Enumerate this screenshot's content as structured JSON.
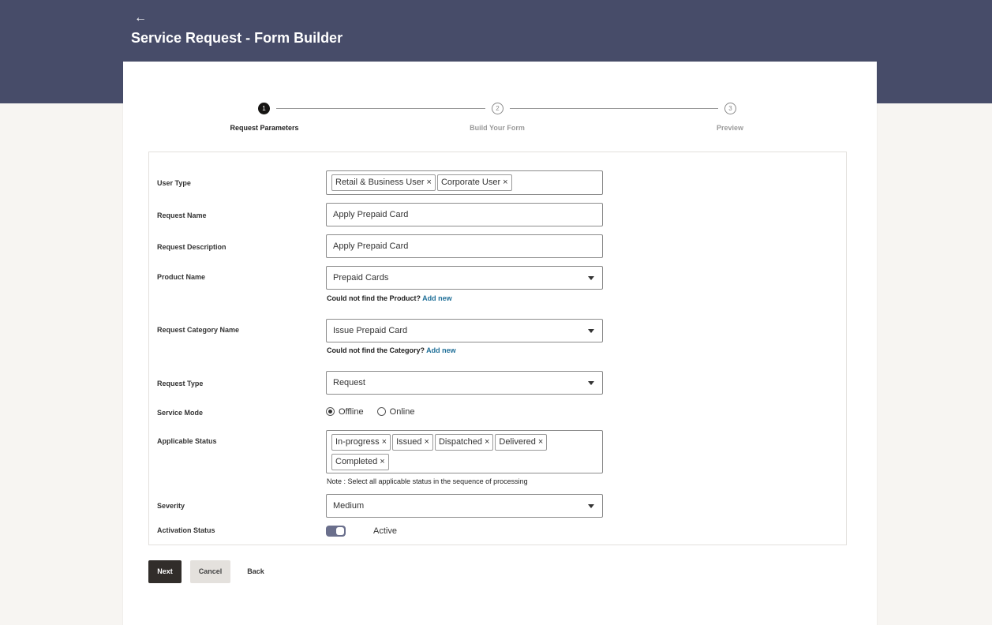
{
  "header": {
    "back_icon": "arrow-left-icon",
    "title": "Service Request - Form Builder"
  },
  "stepper": {
    "steps": [
      {
        "number": "1",
        "label": "Request Parameters",
        "state": "active"
      },
      {
        "number": "2",
        "label": "Build Your Form",
        "state": "pending"
      },
      {
        "number": "3",
        "label": "Preview",
        "state": "pending"
      }
    ]
  },
  "form": {
    "user_type": {
      "label": "User Type",
      "chips": [
        "Retail & Business User",
        "Corporate User"
      ]
    },
    "request_name": {
      "label": "Request Name",
      "value": "Apply Prepaid Card"
    },
    "request_description": {
      "label": "Request Description",
      "value": "Apply Prepaid Card"
    },
    "product_name": {
      "label": "Product Name",
      "value": "Prepaid Cards",
      "helper": "Could not find the Product?",
      "helper_link": "Add new"
    },
    "request_category": {
      "label": "Request Category Name",
      "value": "Issue Prepaid Card",
      "helper": "Could not find the Category?",
      "helper_link": "Add new"
    },
    "request_type": {
      "label": "Request Type",
      "value": "Request"
    },
    "service_mode": {
      "label": "Service Mode",
      "options": [
        "Offline",
        "Online"
      ],
      "selected": "Offline"
    },
    "applicable_status": {
      "label": "Applicable Status",
      "chips": [
        "In-progress",
        "Issued",
        "Dispatched",
        "Delivered",
        "Completed"
      ],
      "note": "Note : Select all applicable status in the sequence of processing"
    },
    "severity": {
      "label": "Severity",
      "value": "Medium"
    },
    "activation_status": {
      "label": "Activation Status",
      "value": "Active",
      "on": true
    }
  },
  "actions": {
    "next": "Next",
    "cancel": "Cancel",
    "back": "Back"
  },
  "colors": {
    "header_bg": "#474c69",
    "primary_button": "#312d2a",
    "link": "#1f6f98",
    "toggle_on": "#6a6f8c"
  }
}
